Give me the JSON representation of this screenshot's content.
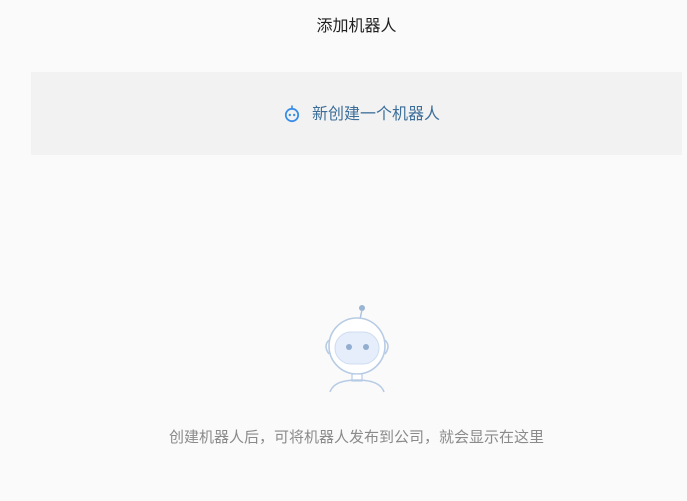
{
  "header": {
    "title": "添加机器人"
  },
  "create_action": {
    "label": "新创建一个机器人",
    "icon": "robot-icon",
    "accent_color": "#3a8ee6"
  },
  "empty_state": {
    "icon": "robot-illustration",
    "text": "创建机器人后，可将机器人发布到公司，就会显示在这里"
  }
}
